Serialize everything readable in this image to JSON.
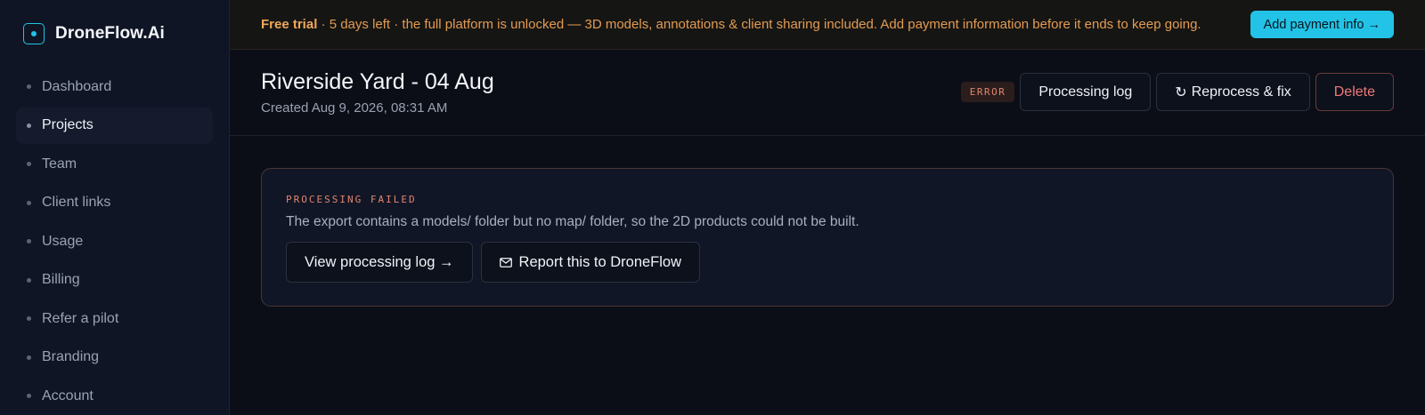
{
  "brand": {
    "name": "DroneFlow.Ai"
  },
  "sidebar": {
    "items": [
      {
        "label": "Dashboard",
        "active": false
      },
      {
        "label": "Projects",
        "active": true
      },
      {
        "label": "Team",
        "active": false
      },
      {
        "label": "Client links",
        "active": false
      },
      {
        "label": "Usage",
        "active": false
      },
      {
        "label": "Billing",
        "active": false
      },
      {
        "label": "Refer a pilot",
        "active": false
      },
      {
        "label": "Branding",
        "active": false
      },
      {
        "label": "Account",
        "active": false
      }
    ]
  },
  "banner": {
    "strong": "Free trial",
    "text": " · 5 days left · the full platform is unlocked — 3D models, annotations & client sharing included. Add payment information before it ends to keep going.",
    "cta_label": "Add payment info →"
  },
  "project": {
    "title": "Riverside Yard - 04 Aug",
    "created": "Created Aug 9, 2026, 08:31 AM",
    "status_badge": "ERROR"
  },
  "actions": {
    "processing_log": "Processing log",
    "reprocess_icon": "↻",
    "reprocess": "Reprocess & fix",
    "delete": "Delete"
  },
  "alert": {
    "eyebrow": "PROCESSING FAILED",
    "message": "The export contains a models/ folder but no map/ folder, so the 2D products could not be built.",
    "view_log": "View processing log →",
    "report": "Report this to DroneFlow"
  },
  "icons": {
    "brand": "drone-logo-icon",
    "reprocess": "refresh-icon",
    "report": "mail-icon"
  },
  "colors": {
    "accent": "#22c3e6",
    "error": "#e0866d",
    "danger": "#ef7a7a",
    "trial": "#e49b52"
  }
}
